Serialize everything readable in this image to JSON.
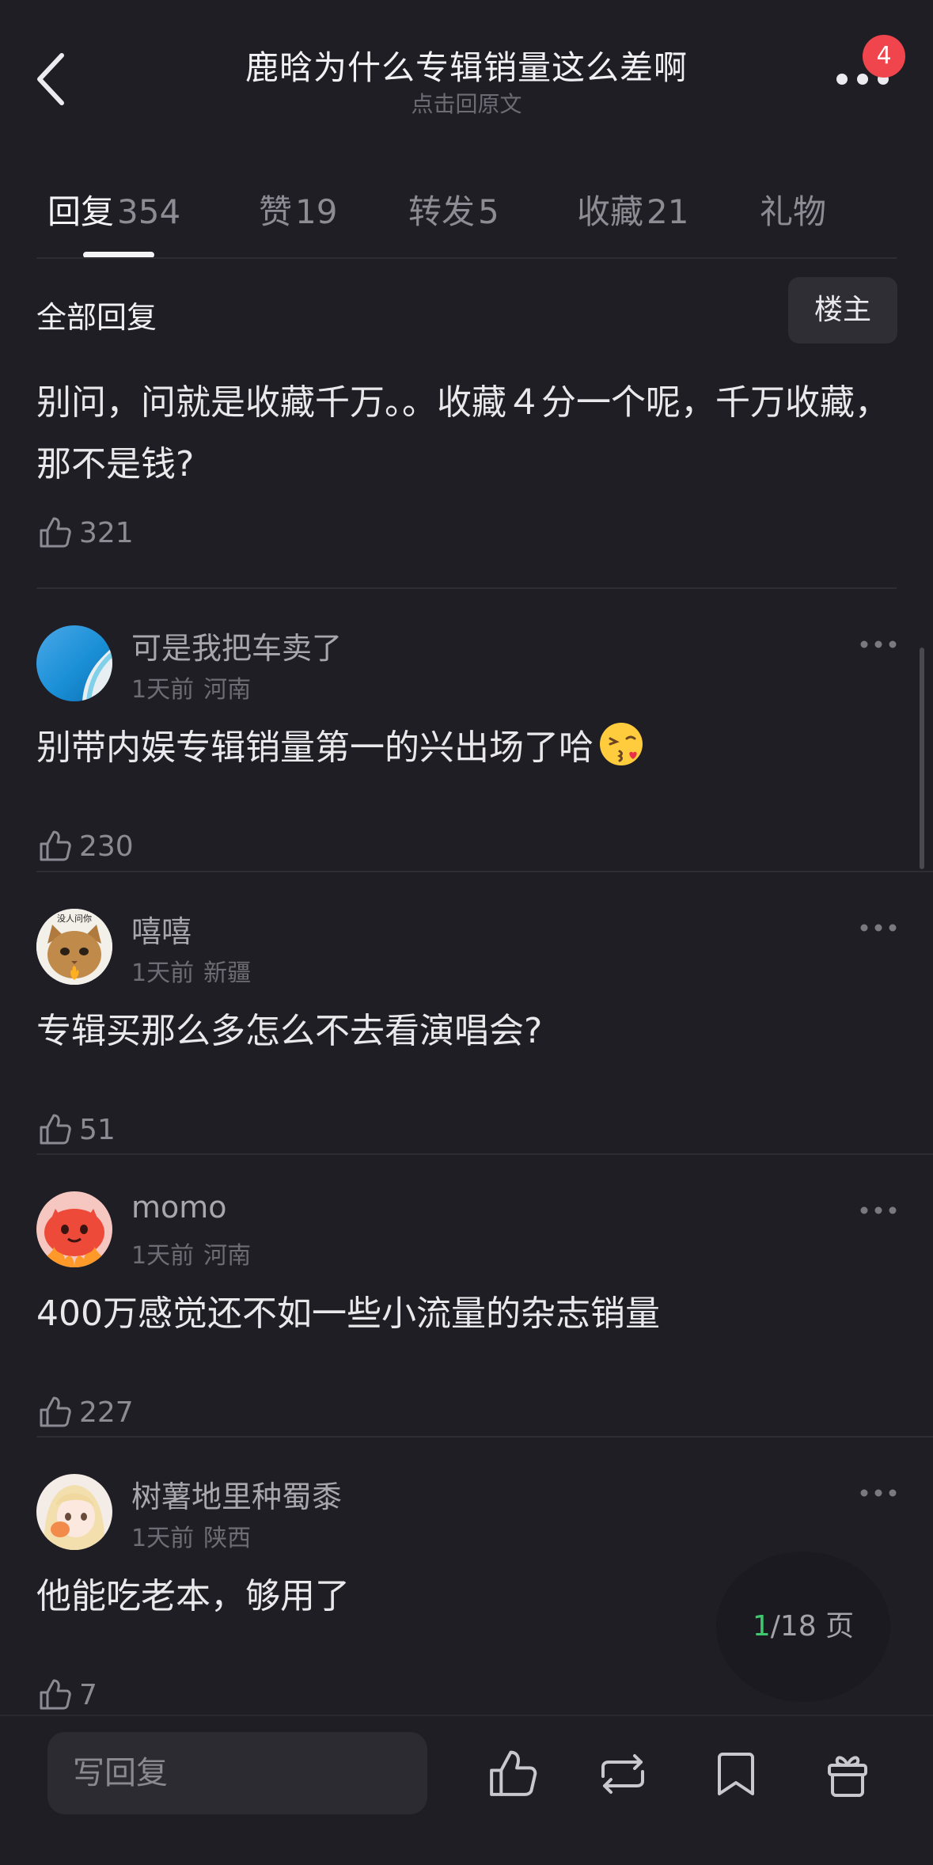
{
  "header": {
    "title": "鹿晗为什么专辑销量这么差啊",
    "subtitle": "点击回原文",
    "badge_count": "4"
  },
  "tabs": [
    {
      "label": "回复",
      "count": "354",
      "active": true
    },
    {
      "label": "赞",
      "count": "19"
    },
    {
      "label": "转发",
      "count": "5"
    },
    {
      "label": "收藏",
      "count": "21"
    },
    {
      "label": "礼物",
      "count": ""
    }
  ],
  "section": {
    "title": "全部回复",
    "op_button": "楼主"
  },
  "comments": [
    {
      "text": "别问，问就是收藏千万。。收藏４分一个呢，千万收藏，那不是钱?",
      "likes": "321"
    },
    {
      "username": "可是我把车卖了",
      "time": "1天前",
      "location": "河南",
      "text": "别带内娱专辑销量第一的兴出场了哈",
      "likes": "230"
    },
    {
      "username": "嘻嘻",
      "avatar_caption": "没人问你",
      "time": "1天前",
      "location": "新疆",
      "text": "专辑买那么多怎么不去看演唱会?",
      "likes": "51"
    },
    {
      "username": "momo",
      "time": "1天前",
      "location": "河南",
      "text": "400万感觉还不如一些小流量的杂志销量",
      "likes": "227"
    },
    {
      "username": "树薯地里种蜀黍",
      "time": "1天前",
      "location": "陕西",
      "text": "他能吃老本，够用了",
      "likes": "7"
    }
  ],
  "pagination": {
    "current": "1",
    "total": "/18 页"
  },
  "bottom_bar": {
    "reply_placeholder": "写回复"
  },
  "colors": {
    "background": "#1f1e24",
    "badge": "#f0454d",
    "page_current": "#3ec96f"
  }
}
